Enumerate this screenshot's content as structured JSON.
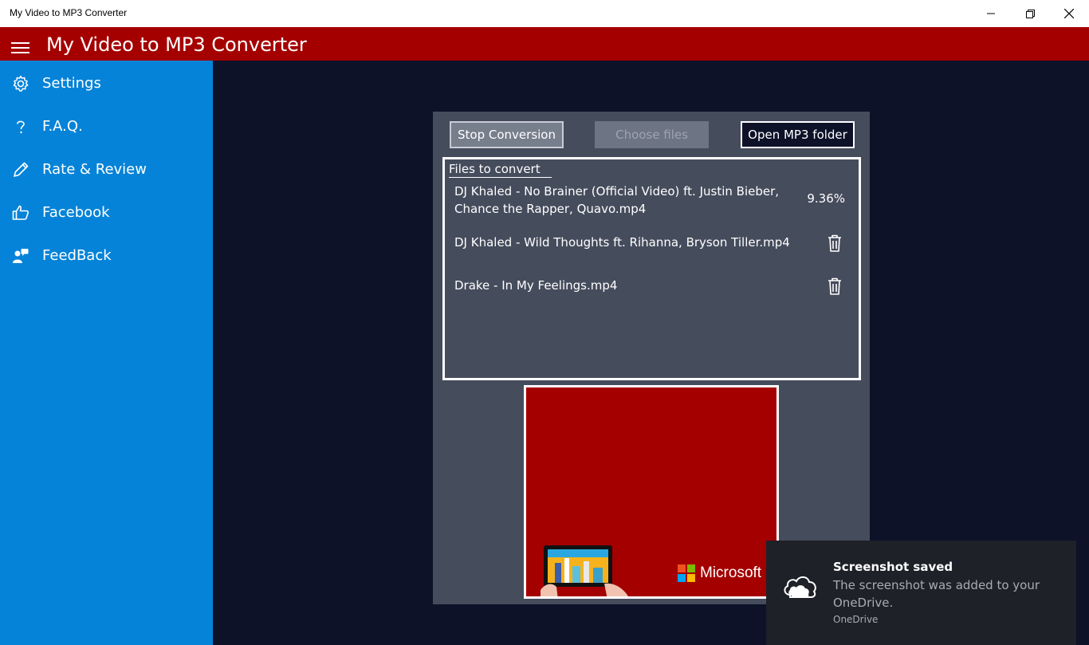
{
  "window": {
    "title": "My Video to MP3 Converter",
    "controls": [
      "minimize",
      "restore",
      "close"
    ]
  },
  "header": {
    "title": "My Video to MP3 Converter",
    "menu_icon": "hamburger-menu-icon",
    "color": "#a50000"
  },
  "sidebar": {
    "color": "#0583d8",
    "items": [
      {
        "label": "Settings",
        "icon": "gear-icon"
      },
      {
        "label": "F.A.Q.",
        "icon": "question-mark-icon"
      },
      {
        "label": "Rate & Review",
        "icon": "pencil-icon"
      },
      {
        "label": "Facebook",
        "icon": "thumbs-up-icon"
      },
      {
        "label": "FeedBack",
        "icon": "feedback-person-icon"
      }
    ]
  },
  "toolbar": {
    "stop_label": "Stop Conversion",
    "choose_label": "Choose files",
    "choose_disabled": true,
    "open_label": "Open MP3 folder"
  },
  "files": {
    "title": "Files to convert",
    "items": [
      {
        "name": "DJ Khaled - No Brainer (Official Video) ft. Justin Bieber, Chance the Rapper, Quavo.mp4",
        "progress": "9.36%"
      },
      {
        "name": "DJ Khaled - Wild Thoughts ft. Rihanna, Bryson Tiller.mp4",
        "action_icon": "trash-icon"
      },
      {
        "name": "Drake - In My Feelings.mp4",
        "action_icon": "trash-icon"
      }
    ]
  },
  "ad": {
    "brand": "Microsoft",
    "background": "#a50000"
  },
  "toast": {
    "title": "Screenshot saved",
    "body": "The screenshot was added to your OneDrive.",
    "source": "OneDrive",
    "icon": "onedrive-cloud-icon"
  }
}
